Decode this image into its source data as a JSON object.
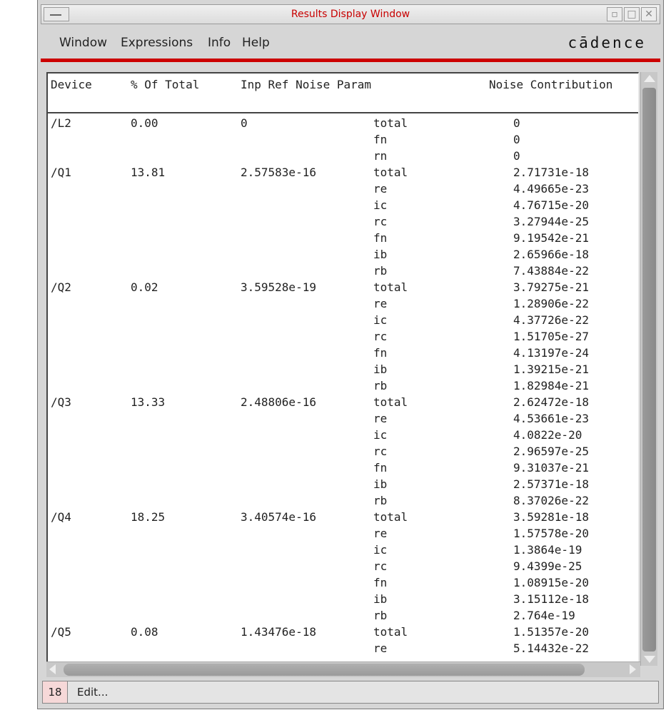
{
  "window": {
    "title": "Results Display Window",
    "title_color": "#c80000",
    "brand": "cādence",
    "accent_color": "#cc0000"
  },
  "menu": [
    {
      "label": "Window"
    },
    {
      "label": "Expressions"
    },
    {
      "label": "Info"
    },
    {
      "label": "Help"
    }
  ],
  "table": {
    "headers": [
      "Device",
      "% Of Total",
      "Inp Ref Noise Param",
      "Noise Contribution"
    ],
    "rows": [
      [
        "/L2",
        "0.00",
        "0",
        "total",
        "0"
      ],
      [
        "",
        "",
        "",
        "fn",
        "0"
      ],
      [
        "",
        "",
        "",
        "rn",
        "0"
      ],
      [
        "/Q1",
        "13.81",
        "2.57583e-16",
        "total",
        "2.71731e-18"
      ],
      [
        "",
        "",
        "",
        "re",
        "4.49665e-23"
      ],
      [
        "",
        "",
        "",
        "ic",
        "4.76715e-20"
      ],
      [
        "",
        "",
        "",
        "rc",
        "3.27944e-25"
      ],
      [
        "",
        "",
        "",
        "fn",
        "9.19542e-21"
      ],
      [
        "",
        "",
        "",
        "ib",
        "2.65966e-18"
      ],
      [
        "",
        "",
        "",
        "rb",
        "7.43884e-22"
      ],
      [
        "/Q2",
        "0.02",
        "3.59528e-19",
        "total",
        "3.79275e-21"
      ],
      [
        "",
        "",
        "",
        "re",
        "1.28906e-22"
      ],
      [
        "",
        "",
        "",
        "ic",
        "4.37726e-22"
      ],
      [
        "",
        "",
        "",
        "rc",
        "1.51705e-27"
      ],
      [
        "",
        "",
        "",
        "fn",
        "4.13197e-24"
      ],
      [
        "",
        "",
        "",
        "ib",
        "1.39215e-21"
      ],
      [
        "",
        "",
        "",
        "rb",
        "1.82984e-21"
      ],
      [
        "/Q3",
        "13.33",
        "2.48806e-16",
        "total",
        "2.62472e-18"
      ],
      [
        "",
        "",
        "",
        "re",
        "4.53661e-23"
      ],
      [
        "",
        "",
        "",
        "ic",
        "4.0822e-20"
      ],
      [
        "",
        "",
        "",
        "rc",
        "2.96597e-25"
      ],
      [
        "",
        "",
        "",
        "fn",
        "9.31037e-21"
      ],
      [
        "",
        "",
        "",
        "ib",
        "2.57371e-18"
      ],
      [
        "",
        "",
        "",
        "rb",
        "8.37026e-22"
      ],
      [
        "/Q4",
        "18.25",
        "3.40574e-16",
        "total",
        "3.59281e-18"
      ],
      [
        "",
        "",
        "",
        "re",
        "1.57578e-20"
      ],
      [
        "",
        "",
        "",
        "ic",
        "1.3864e-19"
      ],
      [
        "",
        "",
        "",
        "rc",
        "9.4399e-25"
      ],
      [
        "",
        "",
        "",
        "fn",
        "1.08915e-20"
      ],
      [
        "",
        "",
        "",
        "ib",
        "3.15112e-18"
      ],
      [
        "",
        "",
        "",
        "rb",
        "2.764e-19"
      ],
      [
        "/Q5",
        "0.08",
        "1.43476e-18",
        "total",
        "1.51357e-20"
      ],
      [
        "",
        "",
        "",
        "re",
        "5.14432e-22"
      ]
    ]
  },
  "status": {
    "count": "18",
    "text": "Edit..."
  }
}
